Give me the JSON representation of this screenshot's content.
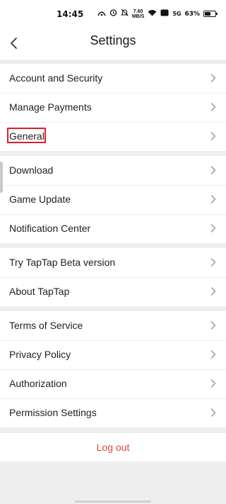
{
  "status_bar": {
    "time": "14:45",
    "net_speed_value": "7.60",
    "net_speed_unit": "MB/S",
    "signal_label": "5G",
    "battery_percent": "63%",
    "battery_level": 0.63
  },
  "header": {
    "title": "Settings"
  },
  "groups": [
    {
      "items": [
        {
          "label": "Account and Security"
        },
        {
          "label": "Manage Payments"
        },
        {
          "label": "General"
        }
      ]
    },
    {
      "items": [
        {
          "label": "Download"
        },
        {
          "label": "Game Update"
        },
        {
          "label": "Notification Center"
        }
      ]
    },
    {
      "items": [
        {
          "label": "Try TapTap Beta version"
        },
        {
          "label": "About TapTap"
        }
      ]
    },
    {
      "items": [
        {
          "label": "Terms of Service"
        },
        {
          "label": "Privacy Policy"
        },
        {
          "label": "Authorization"
        },
        {
          "label": "Permission Settings"
        }
      ]
    }
  ],
  "logout_label": "Log out",
  "colors": {
    "background": "#eeeeee",
    "logout_text": "#e5413e",
    "highlight_box": "#e01e2b"
  },
  "icons": [
    "back-arrow-icon",
    "chevron-right-icon",
    "wifi-icon",
    "alarm-icon",
    "mute-icon",
    "battery-icon"
  ]
}
